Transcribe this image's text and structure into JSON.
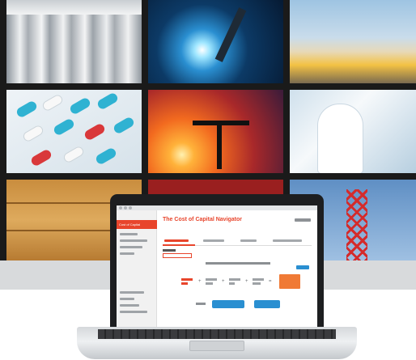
{
  "screen": {
    "brand_label": "Cost of Capital",
    "app_title": "The Cost of Capital Navigator"
  },
  "colors": {
    "accent": "#e8452c",
    "button": "#2a8fd1",
    "result": "#f07a35",
    "laptop_body": "#1d1e20"
  },
  "icons": [
    "construction-icon",
    "welding-icon",
    "columns-icon",
    "pills-icon",
    "oil-pump-icon",
    "lab-scientist-icon",
    "boxes-icon",
    "tower-icon"
  ]
}
